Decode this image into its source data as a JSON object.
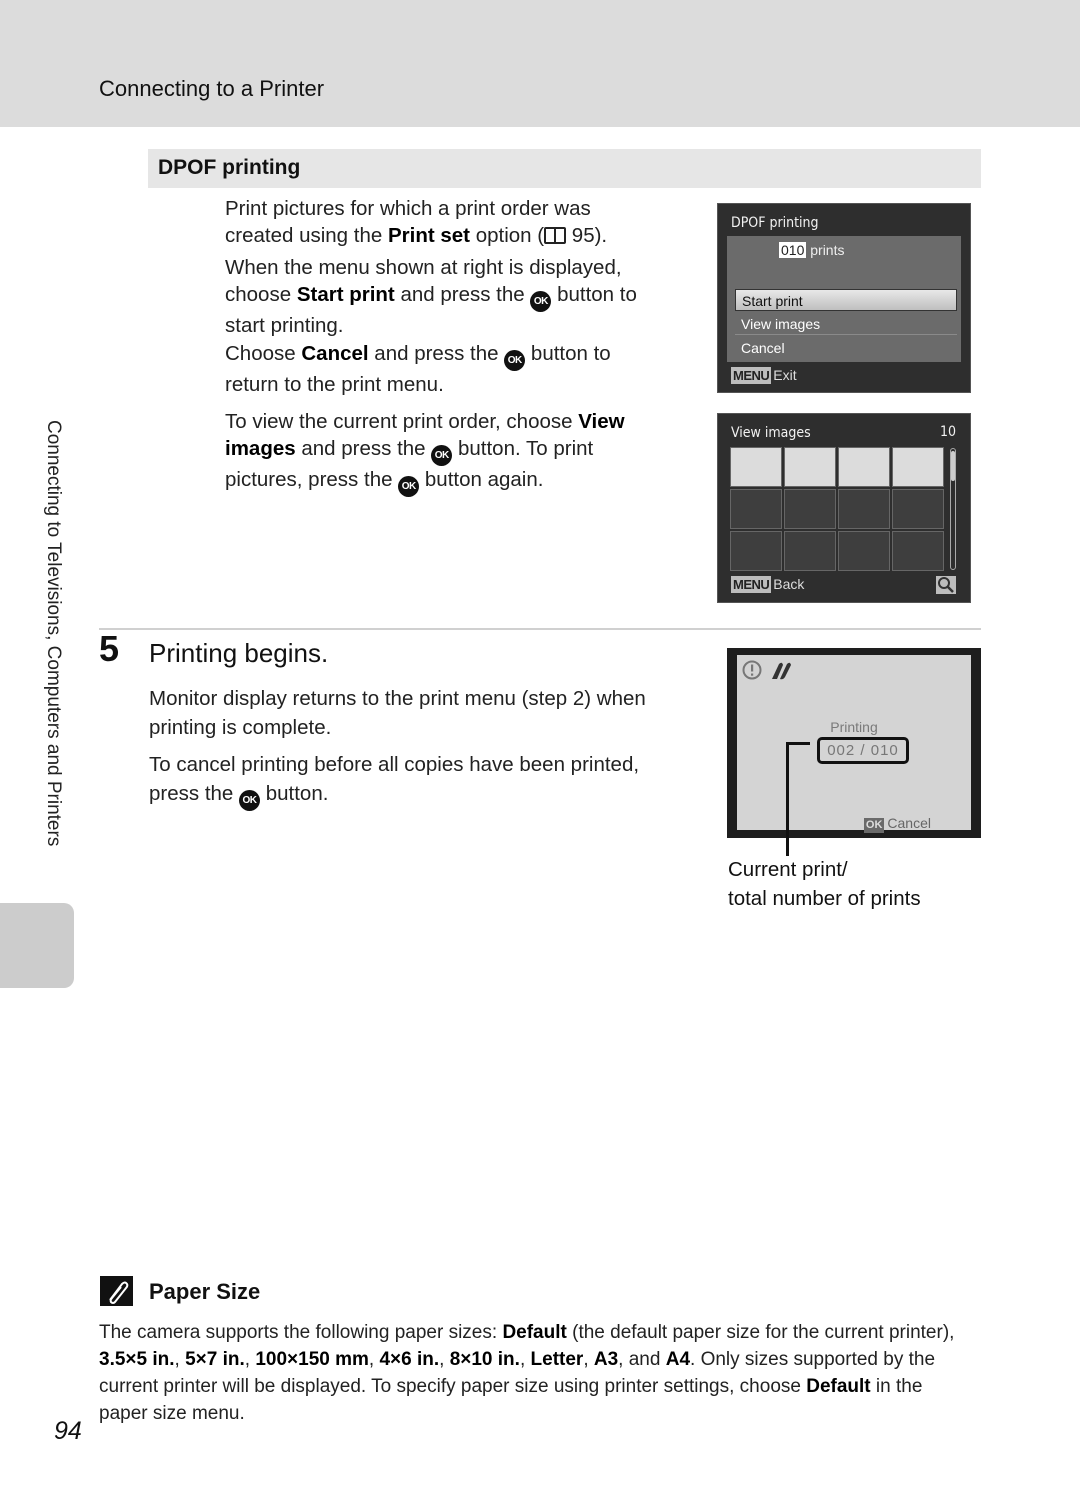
{
  "header": {
    "title": "Connecting to a Printer"
  },
  "section": {
    "title": "DPOF printing"
  },
  "dpof": {
    "p1": [
      "Print pictures for which a print order was",
      "created using the ",
      "Print set",
      " option (",
      " 95)."
    ],
    "p2": [
      "When the menu shown at right is displayed,",
      "choose ",
      "Start print",
      " and press the ",
      " button to",
      "start printing."
    ],
    "p3": [
      "Choose ",
      "Cancel",
      " and press the ",
      " button to",
      "return to the print menu."
    ],
    "p4": [
      "To view the current print order, choose ",
      "View",
      "images",
      " and press the ",
      " button. To print",
      "pictures, press the ",
      " button again."
    ]
  },
  "ok_glyph": "OK",
  "screen1": {
    "title": "DPOF printing",
    "count": "010",
    "count_unit": "prints",
    "menu": [
      {
        "label": "Start print",
        "selected": true
      },
      {
        "label": "View images",
        "selected": false
      },
      {
        "label": "Cancel",
        "selected": false
      }
    ],
    "menu_key": "MENU",
    "footer": "Exit"
  },
  "screen2": {
    "title": "View images",
    "count": "10",
    "menu_key": "MENU",
    "footer": "Back",
    "filled_thumbnails": 4,
    "total_slots": 12
  },
  "step5": {
    "number": "5",
    "title": "Printing begins.",
    "p1": "Monitor display returns to the print menu (step 2) when printing is complete.",
    "p2a": "To cancel printing before all copies have been printed,",
    "p2b": "press the ",
    "p2c": " button."
  },
  "screen3": {
    "status": "Printing",
    "counter": "002 / 010",
    "ok_key": "OK",
    "cancel": "Cancel"
  },
  "caption": {
    "line1": "Current print/",
    "line2": "total number of prints"
  },
  "side": {
    "chapter": "Connecting to Televisions, Computers and Printers"
  },
  "note": {
    "title": "Paper Size",
    "t1": "The camera supports the following paper sizes: ",
    "b1": "Default",
    "t2": " (the default paper size for the current printer), ",
    "b2": "3.5×5 in.",
    "b3": "5×7 in.",
    "b4": "100×150 mm",
    "b5": "4×6 in.",
    "b6": "8×10 in.",
    "b7": "Letter",
    "b8": "A3",
    "t3": ", and ",
    "b9": "A4",
    "t4": ". Only sizes supported by the current printer will be displayed. To specify paper size using printer settings, choose ",
    "b10": "Default",
    "t5": " in the paper size menu."
  },
  "page": {
    "number": "94"
  }
}
